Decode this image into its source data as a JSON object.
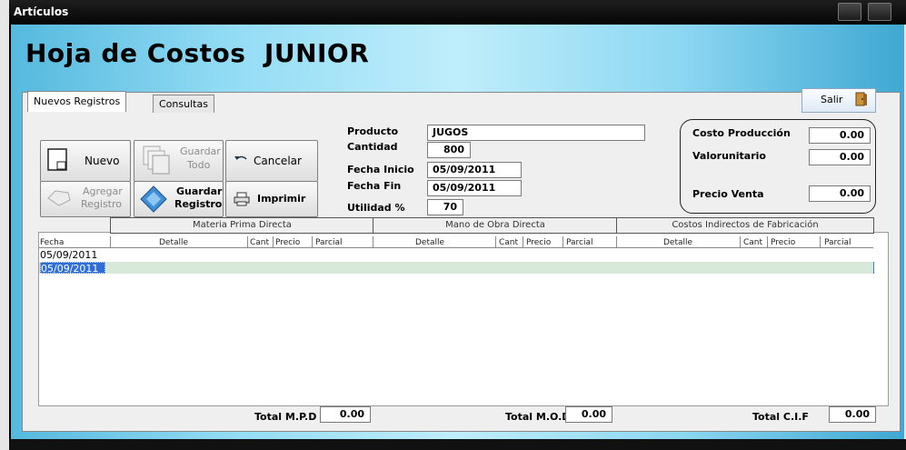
{
  "window": {
    "title": "Artículos"
  },
  "heading": "Hoja de Costos  JUNIOR",
  "tabs": [
    {
      "label": "Nuevos Registros"
    },
    {
      "label": "Consultas"
    }
  ],
  "salir": {
    "label": "Salir"
  },
  "buttons": {
    "nuevo": "Nuevo",
    "guardar_todo_1": "Guardar",
    "guardar_todo_2": "Todo",
    "cancelar": "Cancelar",
    "agregar_1": "Agregar",
    "agregar_2": "Registro",
    "guardar_registro_1": "Guardar",
    "guardar_registro_2": "Registro",
    "imprimir": "Imprimir"
  },
  "form": {
    "producto_label": "Producto",
    "producto_value": "JUGOS",
    "cantidad_label": "Cantidad",
    "cantidad_value": "800",
    "fecha_inicio_label": "Fecha Inicio",
    "fecha_inicio_value": "05/09/2011",
    "fecha_fin_label": "Fecha Fin",
    "fecha_fin_value": "05/09/2011",
    "utilidad_label": "Utilidad %",
    "utilidad_value": "70"
  },
  "costs": {
    "costo_produccion_label": "Costo Producción",
    "costo_produccion_value": "0.00",
    "valor_unitario_label": "Valorunitario",
    "valor_unitario_value": "0.00",
    "precio_venta_label": "Precio Venta",
    "precio_venta_value": "0.00"
  },
  "grid": {
    "groups": [
      "Materia Prima Directa",
      "Mano de Obra Directa",
      "Costos Indirectos de Fabricación"
    ],
    "col_fecha": "Fecha",
    "sub_cols": {
      "detalle": "Detalle",
      "cant": "Cant",
      "precio": "Precio",
      "parcial": "Parcial"
    },
    "rows": [
      "05/09/2011",
      "05/09/2011"
    ]
  },
  "totals": {
    "mpd_label": "Total M.P.D",
    "mpd_value": "0.00",
    "mod_label": "Total M.O.D",
    "mod_value": "0.00",
    "cif_label": "Total C.I.F",
    "cif_value": "0.00"
  }
}
